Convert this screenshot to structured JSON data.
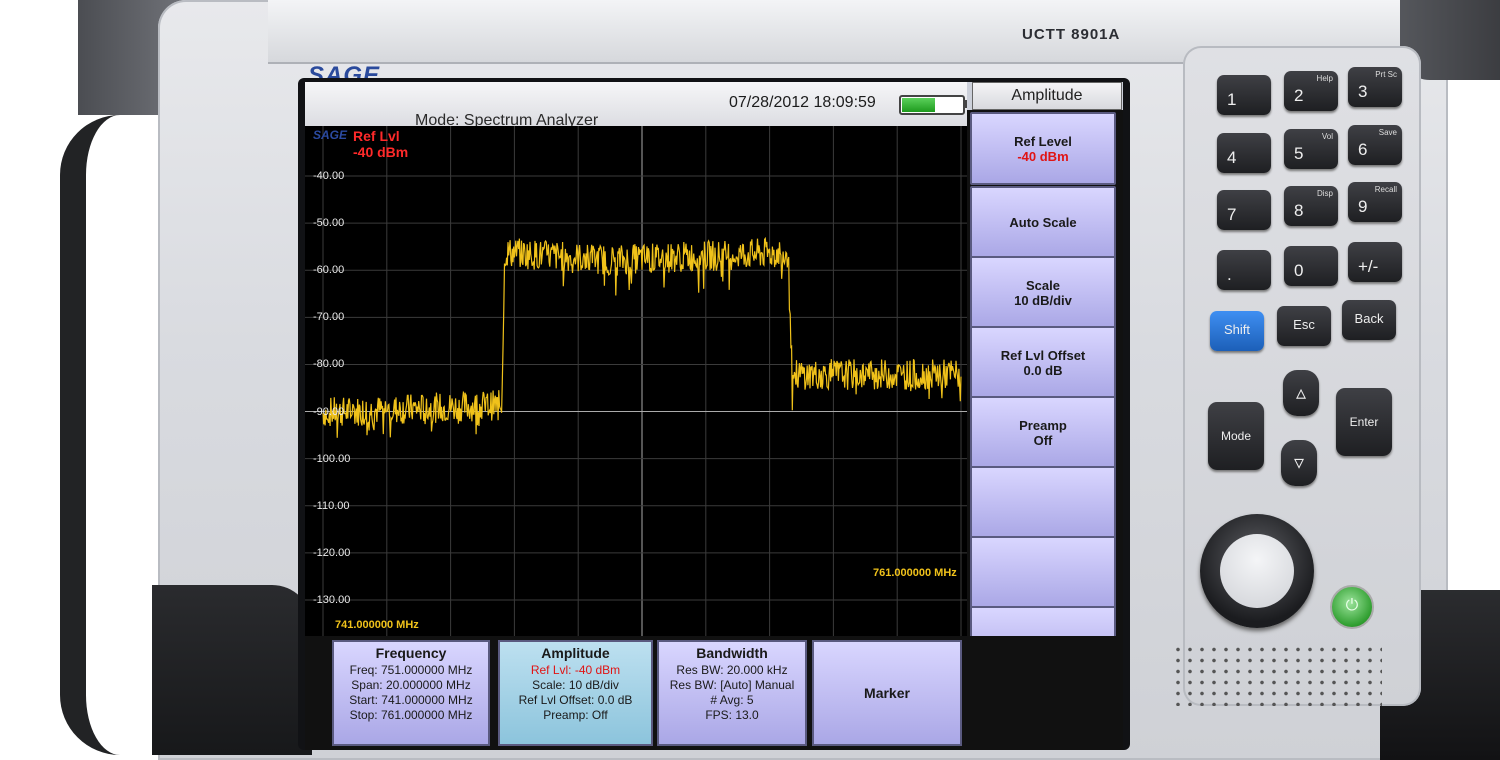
{
  "device": {
    "model": "UCTT 8901A",
    "brand": "SAGE",
    "screen_logo": "SAGE",
    "accent_colors": {
      "softkey": "#b9b6f2",
      "active_panel": "#a8d4e8",
      "trace": "#f0c21a",
      "ref_text": "#ff2a2a",
      "power": "#2f9e2f"
    }
  },
  "header": {
    "mode": "Mode: Spectrum Analyzer",
    "datetime": "07/28/2012 18:09:59",
    "battery_level": 0.55,
    "active_tab": "Amplitude"
  },
  "plot": {
    "ref_label": "Ref Lvl",
    "ref_value": "-40 dBm",
    "y_ticks": [
      "-40.00",
      "-50.00",
      "-60.00",
      "-70.00",
      "-80.00",
      "-90.00",
      "-100.00",
      "-110.00",
      "-120.00",
      "-130.00"
    ],
    "start_freq": "741.000000 MHz",
    "stop_freq": "761.000000 MHz"
  },
  "chart_data": {
    "type": "line",
    "ylim": [
      -140,
      -40
    ],
    "xlim": [
      741,
      761
    ],
    "grid": true,
    "series": [
      {
        "x": [
          741,
          746.6,
          746.7,
          750,
          755.6,
          755.7,
          761
        ],
        "y": [
          -102,
          -100,
          -60,
          -62,
          -60,
          -92,
          -92
        ]
      }
    ]
  },
  "softkeys": [
    {
      "label": "Ref Level",
      "value": "-40 dBm"
    },
    {
      "label": "Auto Scale",
      "value": ""
    },
    {
      "label": "Scale",
      "value": "10 dB/div"
    },
    {
      "label": "Ref Lvl Offset",
      "value": "0.0 dB"
    },
    {
      "label": "Preamp",
      "value": "Off"
    },
    {
      "label": "",
      "value": ""
    },
    {
      "label": "",
      "value": ""
    },
    {
      "label": "",
      "value": ""
    }
  ],
  "panels": {
    "frequency": {
      "title": "Frequency",
      "freq": "Freq: 751.000000 MHz",
      "span": "Span: 20.000000 MHz",
      "start": "Start: 741.000000 MHz",
      "stop": "Stop: 761.000000 MHz"
    },
    "amplitude": {
      "title": "Amplitude",
      "ref": "Ref Lvl: -40 dBm",
      "scale": "Scale: 10 dB/div",
      "offset": "Ref Lvl Offset: 0.0 dB",
      "preamp": "Preamp: Off"
    },
    "bandwidth": {
      "title": "Bandwidth",
      "res": "Res BW: 20.000 kHz",
      "res_mode": "Res BW: [Auto] Manual",
      "avg": "# Avg: 5",
      "fps": "FPS: 13.0"
    },
    "marker": {
      "title": "Marker"
    }
  },
  "keypad": {
    "keys": [
      {
        "n": "1",
        "s": ""
      },
      {
        "n": "2",
        "s": "Help"
      },
      {
        "n": "3",
        "s": "Prt Sc"
      },
      {
        "n": "4",
        "s": ""
      },
      {
        "n": "5",
        "s": "Vol"
      },
      {
        "n": "6",
        "s": "Save"
      },
      {
        "n": "7",
        "s": ""
      },
      {
        "n": "8",
        "s": "Disp"
      },
      {
        "n": "9",
        "s": "Recall"
      },
      {
        "n": ".",
        "s": ""
      },
      {
        "n": "0",
        "s": ""
      },
      {
        "n": "+/-",
        "s": ""
      }
    ],
    "shift": "Shift",
    "esc": "Esc",
    "back": "Back",
    "mode": "Mode",
    "enter": "Enter",
    "up_icon": "triangle-up-icon",
    "down_icon": "triangle-down-icon",
    "power_icon": "power-icon"
  }
}
